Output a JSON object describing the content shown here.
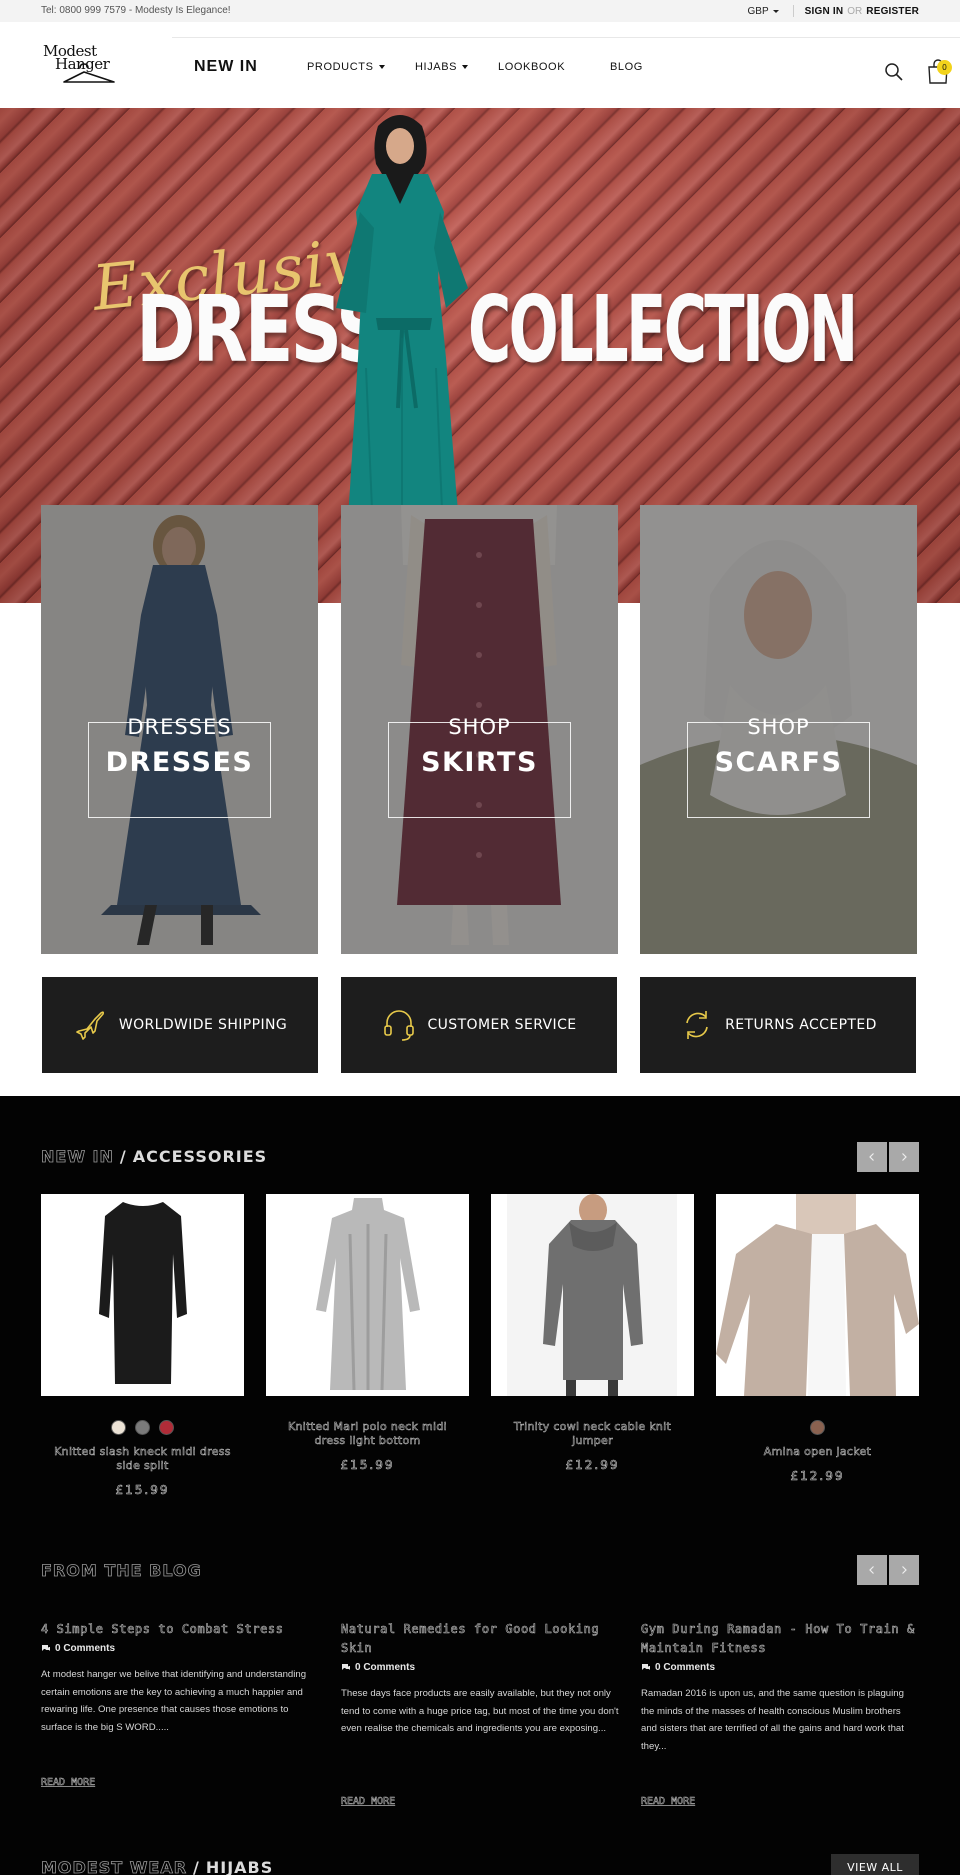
{
  "topbar": {
    "tel": "Tel: 0800 999 7579 - Modesty Is Elegance!",
    "currency": "GBP",
    "signin": "SIGN IN",
    "or": "OR",
    "register": "REGISTER"
  },
  "header": {
    "logo_text": "Modest Hanger",
    "nav": [
      {
        "label": "NEW IN"
      },
      {
        "label": "PRODUCTS"
      },
      {
        "label": "HIJABS"
      },
      {
        "label": "LOOKBOOK"
      },
      {
        "label": "BLOG"
      }
    ],
    "cart_count": "0"
  },
  "hero": {
    "script_text": "Exclusive",
    "word1": "DRESS",
    "word2": "COLLECTION"
  },
  "categories": [
    {
      "line1": "DRESSES",
      "line2": "DRESSES"
    },
    {
      "line1": "SHOP",
      "line2": "SKIRTS"
    },
    {
      "line1": "SHOP",
      "line2": "SCARFS"
    }
  ],
  "services": [
    {
      "label": "WORLDWIDE SHIPPING",
      "icon": "airplane-icon"
    },
    {
      "label": "CUSTOMER SERVICE",
      "icon": "headset-icon"
    },
    {
      "label": "RETURNS ACCEPTED",
      "icon": "refresh-icon"
    }
  ],
  "products_section": {
    "title_dim": "NEW IN",
    "slash": "/",
    "title_bright": "ACCESSORIES"
  },
  "products": [
    {
      "name": "Knitted slash kneck midi dress side split",
      "price": "£15.99",
      "swatches": [
        "#ece3d6",
        "#7a7a7a",
        "#b02c38"
      ]
    },
    {
      "name": "Knitted Marl polo neck midi dress light bottom",
      "price": "£15.99",
      "swatches": []
    },
    {
      "name": "Trinity cowl neck cable knit jumper",
      "price": "£12.99",
      "swatches": []
    },
    {
      "name": "Amina open jacket",
      "price": "£12.99",
      "swatches": [
        "#8a6250"
      ]
    }
  ],
  "blog_section": {
    "title": "FROM THE BLOG"
  },
  "posts": [
    {
      "title": "4 Simple Steps to Combat Stress",
      "comments": "0 Comments",
      "excerpt": "At modest hanger we belive that identifying and understanding certain emotions are the key to achieving a much happier and rewaring life. One presence that causes those emotions to surface is the big S WORD.....",
      "more": "READ MORE"
    },
    {
      "title": "Natural Remedies for Good Looking Skin",
      "comments": "0 Comments",
      "excerpt": "These days face products are easily available, but they not only tend to come with a huge price tag, but most of the time you don't even realise the chemicals and ingredients you are exposing...",
      "more": "READ MORE"
    },
    {
      "title": "Gym During Ramadan - How To Train & Maintain Fitness",
      "comments": "0 Comments",
      "excerpt": "Ramadan 2016 is upon us, and the same question is plaguing the minds of the masses of health conscious Muslim brothers and sisters that are terrified of all the gains and hard work that they...",
      "more": "READ MORE"
    }
  ],
  "bottom_section": {
    "title_dim": "MODEST WEAR",
    "slash": "/",
    "title_bright": "HIJABS",
    "view_all": "VIEW ALL"
  }
}
